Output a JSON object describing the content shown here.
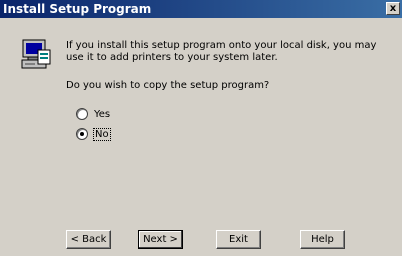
{
  "window": {
    "title": "Install Setup Program",
    "close_label": "x"
  },
  "content": {
    "message": "If you install this setup program onto your local disk, you may use it to add printers to your system later.",
    "question": "Do you wish to copy the setup program?"
  },
  "options": [
    {
      "label": "Yes",
      "selected": false
    },
    {
      "label": "No",
      "selected": true
    }
  ],
  "buttons": {
    "back": "< Back",
    "next": "Next >",
    "exit": "Exit",
    "help": "Help"
  }
}
